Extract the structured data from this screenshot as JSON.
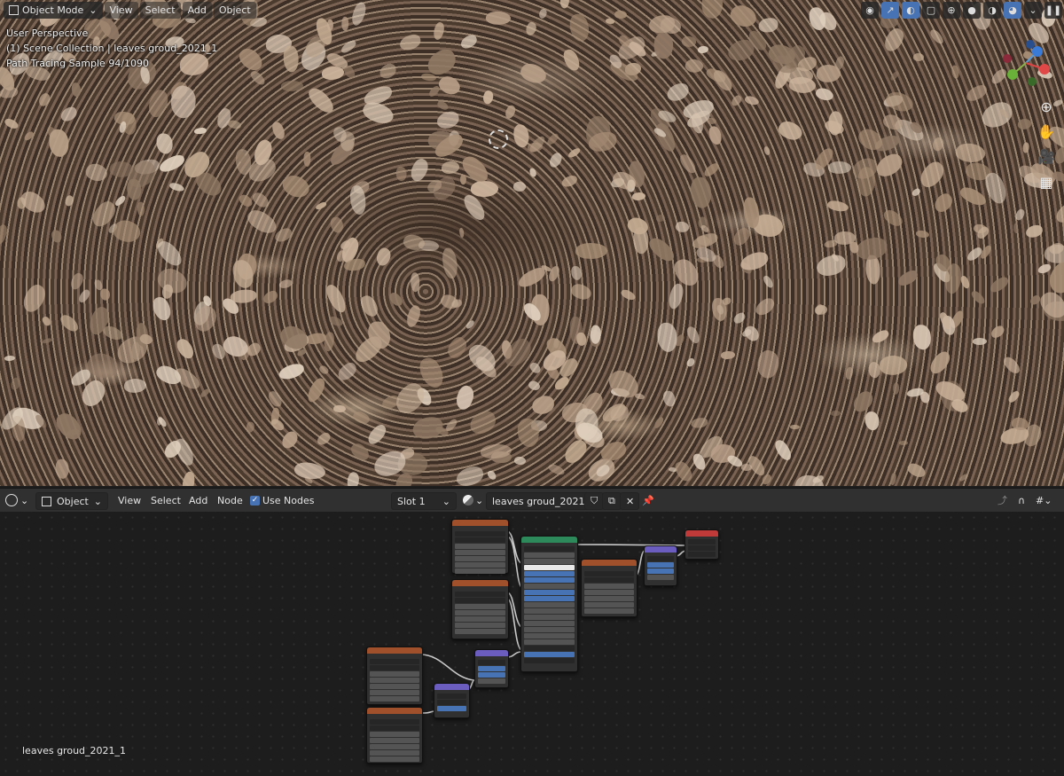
{
  "viewport": {
    "mode": "Object Mode",
    "menus": [
      "View",
      "Select",
      "Add",
      "Object"
    ],
    "overlay": {
      "line1": "User Perspective",
      "line2": "(1) Scene Collection | leaves groud_2021_1",
      "line3": "Path Tracing Sample 94/1090"
    },
    "icons": [
      "view-icon",
      "gizmo-icon",
      "overlay-icon",
      "xray-icon",
      "wireframe-icon",
      "solid-icon",
      "material-icon",
      "rendered-icon"
    ]
  },
  "node_editor": {
    "editor_type_icon": "editor-type-icon",
    "object_select": "Object",
    "menus": [
      "View",
      "Select",
      "Add",
      "Node"
    ],
    "use_nodes_label": "Use Nodes",
    "use_nodes_checked": true,
    "slot": "Slot 1",
    "material_name": "leaves groud_2021_1",
    "status_text": "leaves groud_2021_1"
  },
  "colors": {
    "accent": "#4772b3",
    "texture_header": "#a0502a",
    "shader_header": "#2d8a5b",
    "vector_header": "#6b5dbf",
    "output_header": "#c03a3a"
  }
}
